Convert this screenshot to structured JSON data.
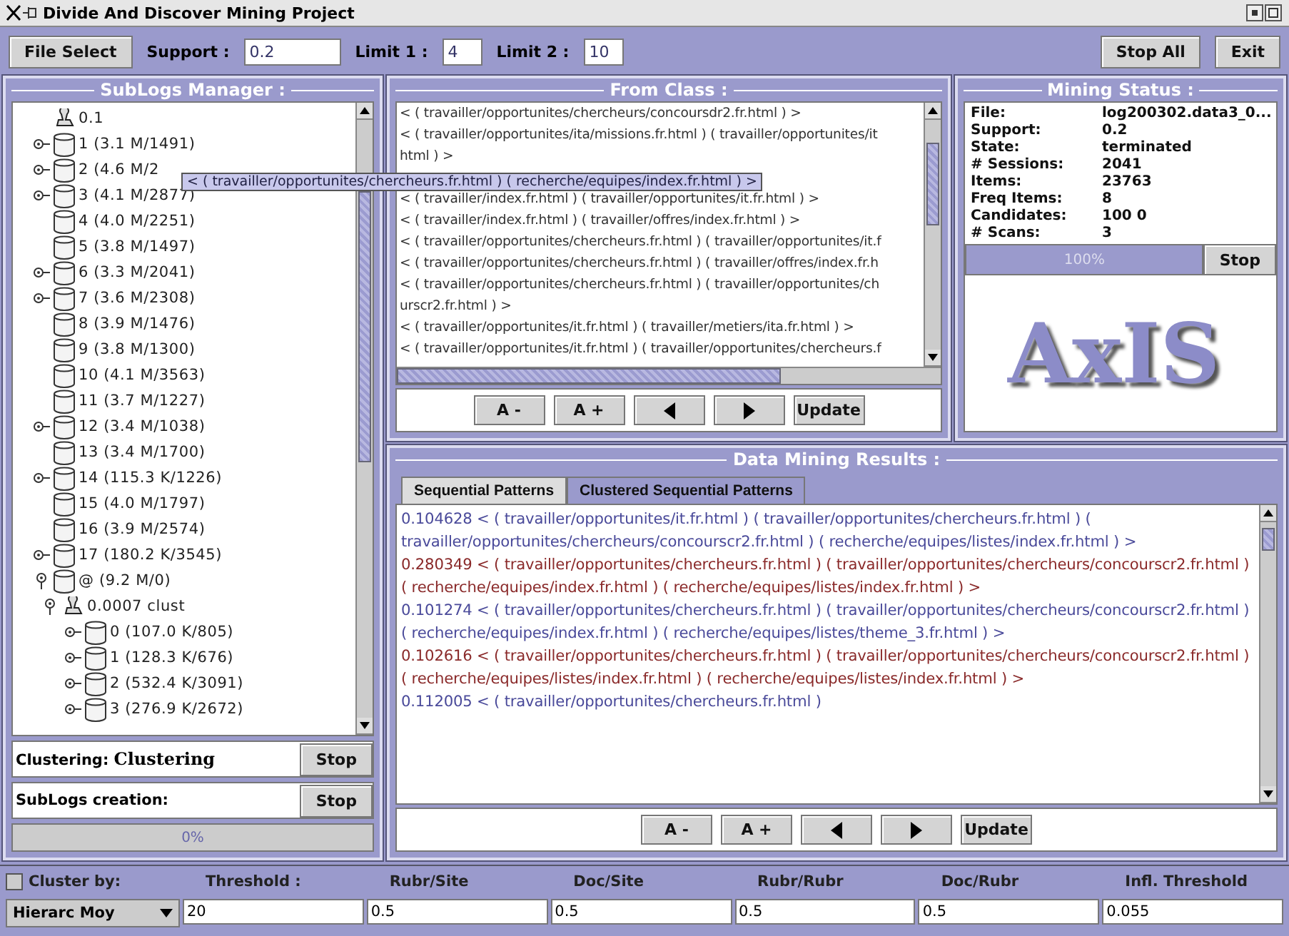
{
  "window": {
    "title": "Divide And Discover Mining Project"
  },
  "toolbar": {
    "file_button": "File Select",
    "fields": [
      {
        "label": "Support :",
        "value": "0.2",
        "kind": "wide"
      },
      {
        "label": "Limit 1 :",
        "value": "4",
        "kind": "narrow"
      },
      {
        "label": "Limit 2 :",
        "value": "10",
        "kind": "narrow"
      }
    ],
    "buttons": [
      "Stop All",
      "Exit"
    ]
  },
  "sublogs": {
    "title": "SubLogs Manager :",
    "tree": [
      {
        "label": "0.1",
        "kind": "clustering"
      },
      {
        "label": "1 (3.1 M/1491)",
        "kind": "log",
        "expanded": false
      },
      {
        "label": "2 (4.6 M/2",
        "kind": "log",
        "expanded": false
      },
      {
        "label": "3 (4.1 M/2877)",
        "kind": "log",
        "expanded": false
      },
      {
        "label": "4 (4.0 M/2251)",
        "kind": "log"
      },
      {
        "label": "5 (3.8 M/1497)",
        "kind": "log"
      },
      {
        "label": "6 (3.3 M/2041)",
        "kind": "log",
        "expanded": false
      },
      {
        "label": "7 (3.6 M/2308)",
        "kind": "log",
        "expanded": false
      },
      {
        "label": "8 (3.9 M/1476)",
        "kind": "log"
      },
      {
        "label": "9 (3.8 M/1300)",
        "kind": "log"
      },
      {
        "label": "10 (4.1 M/3563)",
        "kind": "log"
      },
      {
        "label": "11 (3.7 M/1227)",
        "kind": "log"
      },
      {
        "label": "12 (3.4 M/1038)",
        "kind": "log",
        "expanded": false
      },
      {
        "label": "13 (3.4 M/1700)",
        "kind": "log"
      },
      {
        "label": "14 (115.3 K/1226)",
        "kind": "log",
        "expanded": false
      },
      {
        "label": "15 (4.0 M/1797)",
        "kind": "log"
      },
      {
        "label": "16 (3.9 M/2574)",
        "kind": "log"
      },
      {
        "label": "17 (180.2 K/3545)",
        "kind": "log",
        "expanded": false
      },
      {
        "label": "@ (9.2 M/0)",
        "kind": "log",
        "expanded": true,
        "children": [
          {
            "label": "0.0007 clust",
            "kind": "clustering",
            "expanded": true,
            "children": [
              {
                "label": "0 (107.0 K/805)",
                "kind": "log",
                "expanded": false
              },
              {
                "label": "1 (128.3 K/676)",
                "kind": "log",
                "expanded": false
              },
              {
                "label": "2 (532.4 K/3091)",
                "kind": "log",
                "expanded": false
              },
              {
                "label": "3 (276.9 K/2672)",
                "kind": "log",
                "expanded": false
              }
            ]
          }
        ]
      }
    ],
    "clustering": {
      "label": "Clustering:",
      "value": "Clustering",
      "button": "Stop"
    },
    "creation": {
      "label": "SubLogs creation:",
      "button": "Stop"
    },
    "progress": {
      "level": 0,
      "reading": "0%"
    }
  },
  "tooltip": "< ( travailler/opportunites/chercheurs.fr.html ) ( recherche/equipes/index.fr.html ) >",
  "from_class": {
    "title": "From Class :",
    "lines": [
      "< ( travailler/opportunites/chercheurs/concoursdr2.fr.html ) >",
      "< ( travailler/opportunites/ita/missions.fr.html ) ( travailler/opportunites/it",
      "html ) >",
      "< ( travailler/index.fr.html ) ( travailler/opportunites/it.fr.html ) >",
      "< ( travailler/index.fr.html ) ( travailler/offres/index.fr.html ) >",
      "< ( travailler/opportunites/chercheurs.fr.html ) ( travailler/opportunites/it.f",
      "< ( travailler/opportunites/chercheurs.fr.html ) ( travailler/offres/index.fr.h",
      "< ( travailler/opportunites/chercheurs.fr.html ) ( travailler/opportunites/ch",
      "urscr2.fr.html ) >",
      "< ( travailler/opportunites/it.fr.html ) ( travailler/metiers/ita.fr.html ) >",
      "< ( travailler/opportunites/it.fr.html ) ( travailler/opportunites/chercheurs.f"
    ],
    "buttons": [
      {
        "kind": "text",
        "label": "A -"
      },
      {
        "kind": "text",
        "label": "A +"
      },
      {
        "kind": "prev"
      },
      {
        "kind": "next"
      },
      {
        "kind": "text",
        "label": "Update"
      }
    ]
  },
  "mining_status": {
    "title": "Mining Status :",
    "rows": [
      {
        "label": "File:",
        "value": "log200302.data3_0..."
      },
      {
        "label": "Support:",
        "value": "0.2"
      },
      {
        "label": "State:",
        "value": "terminated"
      },
      {
        "label": "# Sessions:",
        "value": "2041"
      },
      {
        "label": "Items:",
        "value": "23763"
      },
      {
        "label": "Freq Items:",
        "value": "8"
      },
      {
        "label": "Candidates:",
        "value": "100 0"
      },
      {
        "label": "# Scans:",
        "value": "3"
      }
    ],
    "progress": {
      "level": 1,
      "reading": "100%"
    },
    "button": "Stop",
    "logo": "AxIS"
  },
  "results": {
    "title": "Data Mining Results :",
    "tabs": [
      {
        "label": "Sequential Patterns",
        "selected": true
      },
      {
        "label": "Clustered Sequential Patterns",
        "selected": false
      }
    ],
    "patterns": [
      {
        "text": "0.104628 < ( travailler/opportunites/it.fr.html ) ( travailler/opportunites/chercheurs.fr.html ) ( travailler/opportunites/chercheurs/concourscr2.fr.html ) ( recherche/equipes/listes/index.fr.html ) >",
        "color": "#4a4a9a"
      },
      {
        "text": "0.280349 < ( travailler/opportunites/chercheurs.fr.html ) ( travailler/opportunites/chercheurs/concourscr2.fr.html ) ( recherche/equipes/index.fr.html ) ( recherche/equipes/listes/index.fr.html ) >",
        "color": "#8a2a2a"
      },
      {
        "text": "0.101274 < ( travailler/opportunites/chercheurs.fr.html ) ( travailler/opportunites/chercheurs/concourscr2.fr.html ) ( recherche/equipes/index.fr.html ) ( recherche/equipes/listes/theme_3.fr.html ) >",
        "color": "#4a4a9a"
      },
      {
        "text": "0.102616 < ( travailler/opportunites/chercheurs.fr.html ) ( travailler/opportunites/chercheurs/concourscr2.fr.html ) ( recherche/equipes/listes/index.fr.html ) ( recherche/equipes/listes/index.fr.html ) >",
        "color": "#8a2a2a"
      },
      {
        "text": "0.112005 < ( travailler/opportunites/chercheurs.fr.html )",
        "color": "#4a4a9a"
      }
    ],
    "buttons": [
      {
        "kind": "text",
        "label": "A -"
      },
      {
        "kind": "text",
        "label": "A +"
      },
      {
        "kind": "prev"
      },
      {
        "kind": "next"
      },
      {
        "kind": "text",
        "label": "Update"
      }
    ]
  },
  "cluster_bar": {
    "checkbox": {
      "label": "Cluster by:",
      "checked": false
    },
    "columns": [
      "Threshold :",
      "Rubr/Site",
      "Doc/Site",
      "Rubr/Rubr",
      "Doc/Rubr",
      "Infl. Threshold"
    ],
    "method": "Hierarc Moy",
    "values": [
      "20",
      "0.5",
      "0.5",
      "0.5",
      "0.5",
      "0.055"
    ]
  }
}
